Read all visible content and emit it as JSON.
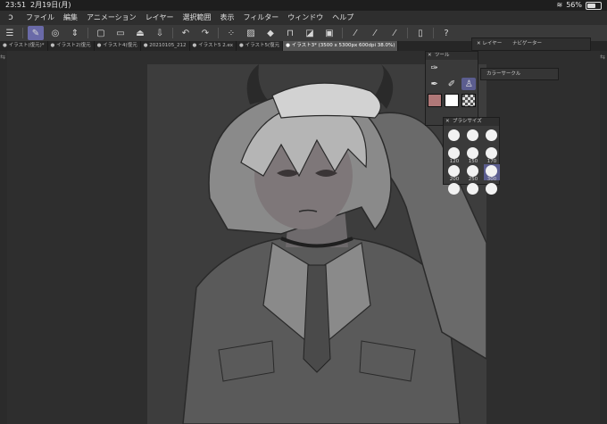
{
  "status": {
    "time": "23:51",
    "date": "2月19日(月)",
    "battery_percent": "56%",
    "battery_level": 0.56
  },
  "menu": [
    "ファイル",
    "編集",
    "アニメーション",
    "レイヤー",
    "選択範囲",
    "表示",
    "フィルター",
    "ウィンドウ",
    "ヘルプ"
  ],
  "tabs": [
    "イラスト(復元)*",
    "イラスト2(復元",
    "イラスト4(復元",
    "20210105_212",
    "イラスト5 2.ex",
    "イラスト5(復元",
    "イラスト3* (3500 x 5300px 600dpi 38.0%)"
  ],
  "panels": {
    "tool_title": "ツール",
    "brush_title": "ブラシサイズ",
    "layer_tab": "レイヤー",
    "layer_tab2": "ナビゲーター",
    "color_tab": "カラーサークル"
  },
  "brush_sizes": [
    {
      "label": ""
    },
    {
      "label": ""
    },
    {
      "label": ""
    },
    {
      "label": "120"
    },
    {
      "label": "150"
    },
    {
      "label": "170"
    },
    {
      "label": "200"
    },
    {
      "label": "250"
    },
    {
      "label": "300"
    },
    {
      "label": ""
    },
    {
      "label": ""
    },
    {
      "label": ""
    }
  ],
  "colors": {
    "main": "#b07878",
    "sub": "#ffffff",
    "accent": "#6a6aa8"
  }
}
